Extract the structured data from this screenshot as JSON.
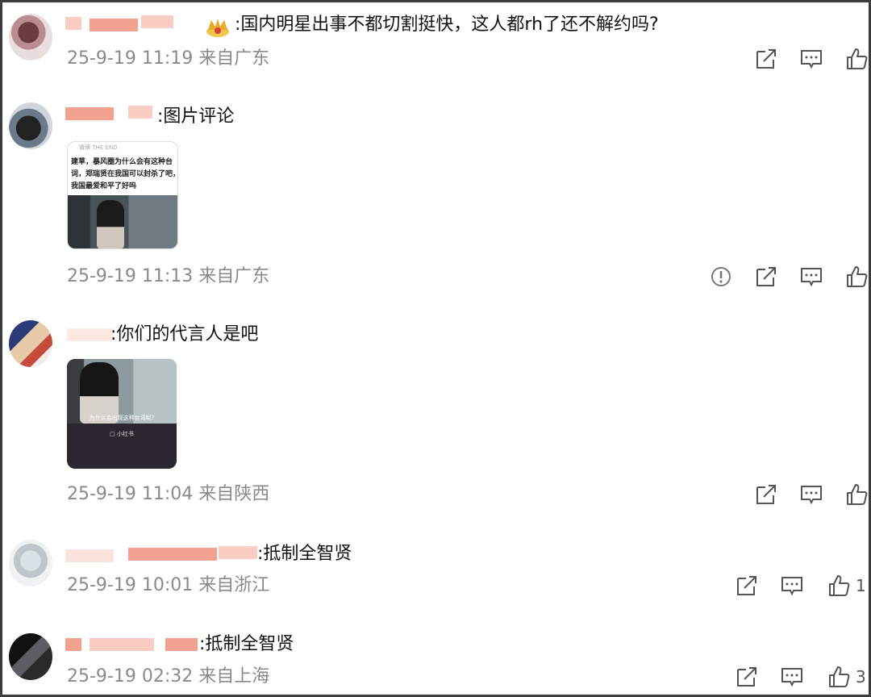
{
  "comments": [
    {
      "text": ":国内明星出事不都切割挺快，这人都rh了还不解约吗?",
      "meta": "25-9-19 11:19 来自广东",
      "like_count": ""
    },
    {
      "text": ":图片评论",
      "meta": "25-9-19 11:13 来自广东",
      "like_count": "",
      "image_caption_lines": [
        "建草，暴风圈为什么会有这种台",
        "词，郑瑞贤在我国可以封杀了吧，",
        "我国最爱和平了好吗"
      ],
      "image_header": "微博 THE END"
    },
    {
      "text": ":你们的代言人是吧",
      "meta": "25-9-19 11:04 来自陕西",
      "like_count": "",
      "image_subtitle": "为什么会出现这种台词呢?",
      "image_small": "□ 小红书"
    },
    {
      "text": ":抵制全智贤",
      "meta": "25-9-19 10:01 来自浙江",
      "like_count": "1"
    },
    {
      "text": ":抵制全智贤",
      "meta": "25-9-19 02:32 来自上海",
      "like_count": "3"
    }
  ],
  "icons": {
    "share": "share-icon",
    "reply": "comment-icon",
    "like": "thumbs-up-icon",
    "report": "report-icon",
    "badge": "crown-badge-icon"
  },
  "colors": {
    "meta_text": "#8a8a8a",
    "blur": "#f0907a",
    "frame": "#3d3d3d"
  }
}
